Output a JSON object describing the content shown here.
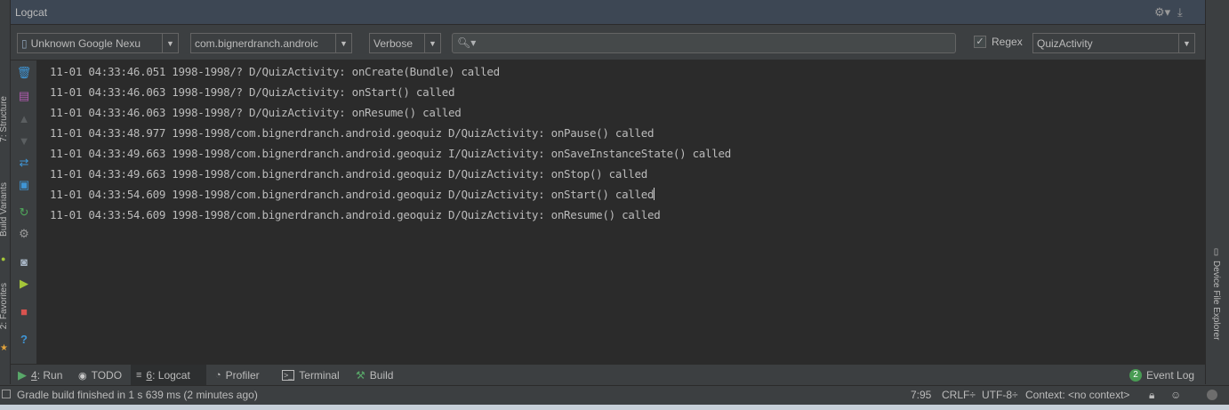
{
  "header": {
    "title": "Logcat"
  },
  "toolbar": {
    "device": "Unknown Google Nexu",
    "process": "com.bignerdranch.androic",
    "level": "Verbose",
    "search_value": "",
    "regex_label": "Regex",
    "regex_checked": true,
    "filter": "QuizActivity"
  },
  "side_tabs": {
    "structure": "7: Structure",
    "build_variants": "Build Variants",
    "favorites": "2: Favorites",
    "device_file_explorer": "Device File Explorer"
  },
  "log_lines": [
    "11-01 04:33:46.051 1998-1998/? D/QuizActivity: onCreate(Bundle) called",
    "11-01 04:33:46.063 1998-1998/? D/QuizActivity: onStart() called",
    "11-01 04:33:46.063 1998-1998/? D/QuizActivity: onResume() called",
    "11-01 04:33:48.977 1998-1998/com.bignerdranch.android.geoquiz D/QuizActivity: onPause() called",
    "11-01 04:33:49.663 1998-1998/com.bignerdranch.android.geoquiz I/QuizActivity: onSaveInstanceState() called",
    "11-01 04:33:49.663 1998-1998/com.bignerdranch.android.geoquiz D/QuizActivity: onStop() called",
    "11-01 04:33:54.609 1998-1998/com.bignerdranch.android.geoquiz D/QuizActivity: onStart() called",
    "11-01 04:33:54.609 1998-1998/com.bignerdranch.android.geoquiz D/QuizActivity: onResume() called"
  ],
  "bottom_tabs": {
    "run_num": "4",
    "run": ": Run",
    "todo": "TODO",
    "logcat_num": "6",
    "logcat": ": Logcat",
    "profiler": "Profiler",
    "terminal": "Terminal",
    "build": "Build",
    "event_log_count": "2",
    "event_log": "Event Log"
  },
  "status": {
    "message": "Gradle build finished in 1 s 639 ms (2 minutes ago)",
    "position": "7:95",
    "line_sep": "CRLF÷",
    "encoding": "UTF-8÷",
    "context": "Context: <no context>"
  },
  "icons": [
    "settings-icon",
    "download-icon",
    "device-phone-icon",
    "search-icon",
    "trash-icon",
    "soft-wrap-icon",
    "up-arrow-icon",
    "down-arrow-icon",
    "filter-icon",
    "print-icon",
    "restart-icon",
    "gear-icon",
    "camera-icon",
    "screen-record-icon",
    "stop-icon",
    "help-icon",
    "run-icon",
    "todo-icon",
    "logcat-icon",
    "profiler-icon",
    "terminal-icon",
    "build-icon",
    "event-log-icon",
    "lock-icon",
    "inspector-icon",
    "star-icon",
    "android-icon",
    "device-file-icon"
  ]
}
